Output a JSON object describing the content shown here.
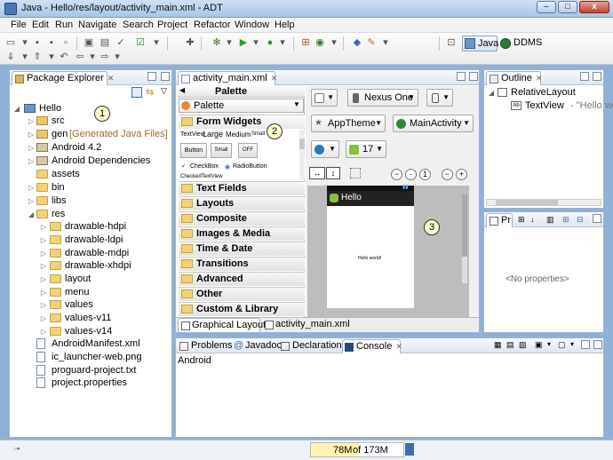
{
  "window": {
    "title": "Java - Hello/res/layout/activity_main.xml - ADT",
    "min": "‒",
    "max": "□",
    "close": "x"
  },
  "menu": [
    "File",
    "Edit",
    "Run",
    "Navigate",
    "Search",
    "Project",
    "Refactor",
    "Window",
    "Help"
  ],
  "perspectives": {
    "java": "Java",
    "ddms": "DDMS"
  },
  "package_explorer": {
    "tab": "Package Explorer",
    "project": "Hello",
    "callout": "1",
    "items": {
      "src": "src",
      "gen": "gen",
      "gen_note": "[Generated Java Files]",
      "android": "Android 4.2",
      "deps": "Android Dependencies",
      "assets": "assets",
      "bin": "bin",
      "libs": "libs",
      "res": "res",
      "dh": "drawable-hdpi",
      "dl": "drawable-ldpi",
      "dm": "drawable-mdpi",
      "dx": "drawable-xhdpi",
      "layout": "layout",
      "menu": "menu",
      "values": "values",
      "v11": "values-v11",
      "v14": "values-v14",
      "manifest": "AndroidManifest.xml",
      "launcher": "ic_launcher-web.png",
      "proguard": "proguard-project.txt",
      "props": "project.properties"
    }
  },
  "editor": {
    "tab": "activity_main.xml",
    "palette_header": "Palette",
    "palette_select": "Palette",
    "callout": "2",
    "form_widgets": "Form Widgets",
    "preview_textviews": {
      "tv": "TextView",
      "large": "Large",
      "medium": "Medium",
      "small": "Small"
    },
    "preview_buttons": {
      "button": "Button",
      "small": "Small",
      "off": "OFF"
    },
    "preview_checks": {
      "checkbox": "CheckBox",
      "radio": "RadioButton"
    },
    "checked_tv": "CheckedTextView",
    "categories": {
      "text_fields": "Text Fields",
      "layouts": "Layouts",
      "composite": "Composite",
      "images_media": "Images & Media",
      "time_date": "Time & Date",
      "transitions": "Transitions",
      "advanced": "Advanced",
      "other": "Other",
      "custom": "Custom & Library Views"
    },
    "device": "Nexus One",
    "theme": "AppTheme",
    "activity": "MainActivity",
    "api": "17",
    "app_title": "Hello",
    "hello_text": "Hello world!",
    "canvas_callout": "3",
    "bottom_tabs": {
      "graphical": "Graphical Layout",
      "xml": "activity_main.xml"
    }
  },
  "outline": {
    "tab": "Outline",
    "root": "RelativeLayout",
    "child": "TextView",
    "child_note": "- \"Hello wo"
  },
  "properties": {
    "tab": "Pr",
    "empty": "<No properties>"
  },
  "console": {
    "tabs": {
      "problems": "Problems",
      "javadoc": "Javadoc",
      "declaration": "Declaration",
      "console": "Console"
    },
    "label": "Android"
  },
  "status": {
    "memory_used": "78M",
    "memory_total": "of 173M"
  },
  "colors": {
    "accent": "#3c6eb4",
    "window": "#8fb0d8",
    "callout": "#fffbcc",
    "action_bar": "#222222"
  }
}
